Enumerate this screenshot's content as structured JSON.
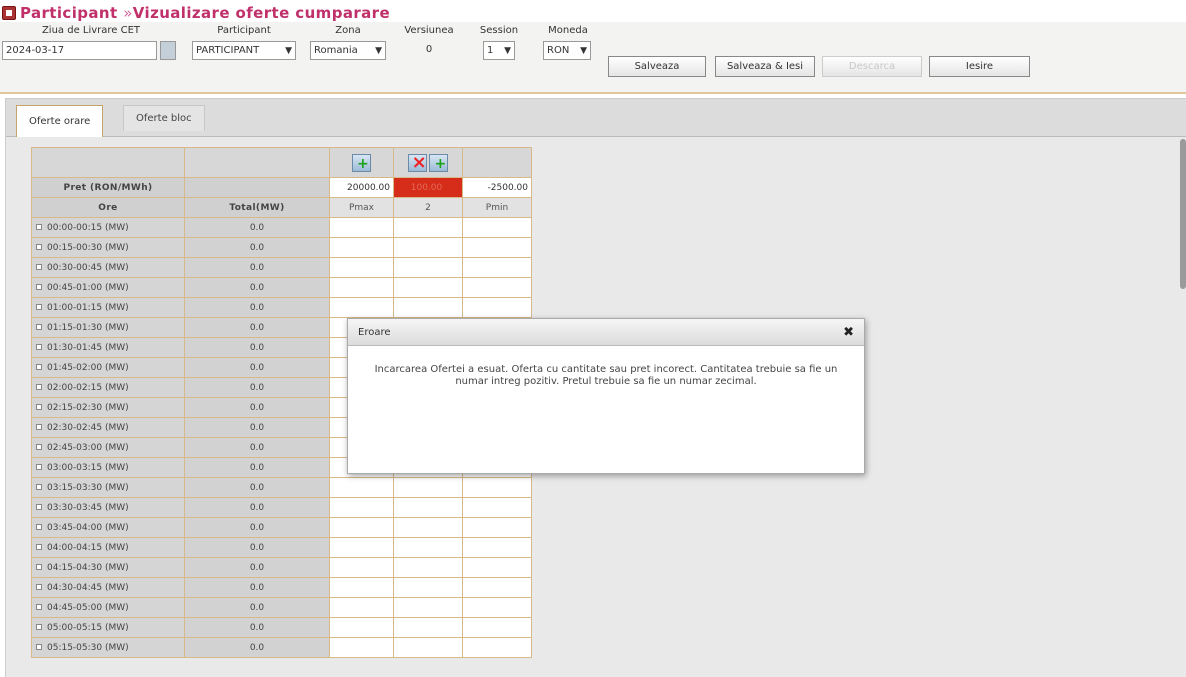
{
  "header": {
    "section": "Participant",
    "separator": "»",
    "page": "Vizualizare oferte cumparare"
  },
  "filters": {
    "delivery_day": {
      "label": "Ziua de Livrare CET",
      "value": "2024-03-17"
    },
    "participant": {
      "label": "Participant",
      "value": "PARTICIPANT"
    },
    "zone": {
      "label": "Zona",
      "value": "Romania"
    },
    "version": {
      "label": "Versiunea",
      "value": "0"
    },
    "session": {
      "label": "Session",
      "value": "1"
    },
    "currency": {
      "label": "Moneda",
      "value": "RON"
    }
  },
  "buttons": {
    "save": "Salveaza",
    "save_exit": "Salveaza & Iesi",
    "download": "Descarca",
    "exit": "Iesire"
  },
  "tabs": [
    "Oferte orare",
    "Oferte bloc"
  ],
  "grid": {
    "price_label": "Pret (RON/MWh)",
    "hours_label": "Ore",
    "total_label": "Total(MW)",
    "prices": [
      "20000.00",
      "100.00",
      "-2500.00"
    ],
    "price_error_index": 1,
    "steps": [
      "Pmax",
      "2",
      "Pmin"
    ],
    "rows": [
      {
        "interval": "00:00-00:15 (MW)",
        "total": "0.0"
      },
      {
        "interval": "00:15-00:30 (MW)",
        "total": "0.0"
      },
      {
        "interval": "00:30-00:45 (MW)",
        "total": "0.0"
      },
      {
        "interval": "00:45-01:00 (MW)",
        "total": "0.0"
      },
      {
        "interval": "01:00-01:15 (MW)",
        "total": "0.0"
      },
      {
        "interval": "01:15-01:30 (MW)",
        "total": "0.0"
      },
      {
        "interval": "01:30-01:45 (MW)",
        "total": "0.0"
      },
      {
        "interval": "01:45-02:00 (MW)",
        "total": "0.0"
      },
      {
        "interval": "02:00-02:15 (MW)",
        "total": "0.0"
      },
      {
        "interval": "02:15-02:30 (MW)",
        "total": "0.0"
      },
      {
        "interval": "02:30-02:45 (MW)",
        "total": "0.0"
      },
      {
        "interval": "02:45-03:00 (MW)",
        "total": "0.0"
      },
      {
        "interval": "03:00-03:15 (MW)",
        "total": "0.0"
      },
      {
        "interval": "03:15-03:30 (MW)",
        "total": "0.0"
      },
      {
        "interval": "03:30-03:45 (MW)",
        "total": "0.0"
      },
      {
        "interval": "03:45-04:00 (MW)",
        "total": "0.0"
      },
      {
        "interval": "04:00-04:15 (MW)",
        "total": "0.0"
      },
      {
        "interval": "04:15-04:30 (MW)",
        "total": "0.0"
      },
      {
        "interval": "04:30-04:45 (MW)",
        "total": "0.0"
      },
      {
        "interval": "04:45-05:00 (MW)",
        "total": "0.0"
      },
      {
        "interval": "05:00-05:15 (MW)",
        "total": "0.0"
      },
      {
        "interval": "05:15-05:30 (MW)",
        "total": "0.0"
      }
    ]
  },
  "dialog": {
    "title": "Eroare",
    "close": "✖",
    "message": "Incarcarea Ofertei a esuat. Oferta cu cantitate sau pret incorect. Cantitatea trebuie sa fie un numar intreg pozitiv. Pretul trebuie sa fie un numar zecimal."
  },
  "icons": {
    "title_icon": "app-icon",
    "add_step": "add-step-icon",
    "delete_step": "delete-step-icon",
    "calendar": "calendar-icon",
    "select_chevron": "chevron-down-icon"
  },
  "colors": {
    "title": "#c0306a",
    "error_cell": "#d62c1a",
    "grid_border": "#d9b98a"
  }
}
